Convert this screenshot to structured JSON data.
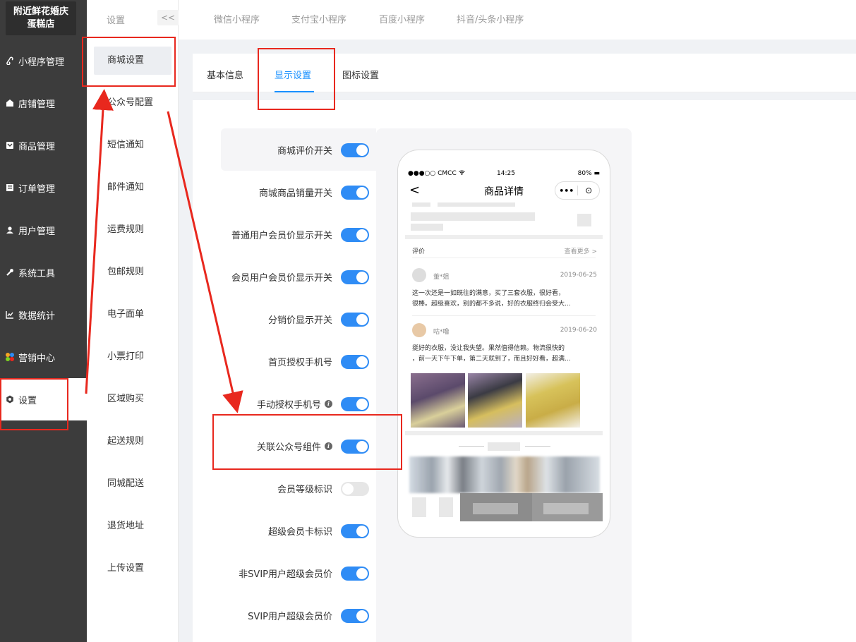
{
  "sidebar": {
    "brand": [
      "附近鲜花婚庆",
      "蛋糕店"
    ],
    "items": [
      {
        "label": "小程序管理",
        "icon": "link-icon"
      },
      {
        "label": "店铺管理",
        "icon": "shop-icon"
      },
      {
        "label": "商品管理",
        "icon": "product-icon"
      },
      {
        "label": "订单管理",
        "icon": "order-icon"
      },
      {
        "label": "用户管理",
        "icon": "user-icon"
      },
      {
        "label": "系统工具",
        "icon": "wrench-icon"
      },
      {
        "label": "数据统计",
        "icon": "chart-icon"
      },
      {
        "label": "营销中心",
        "icon": "marketing-icon"
      },
      {
        "label": "设置",
        "icon": "gear-icon"
      }
    ]
  },
  "sub_sidebar": {
    "heading": "设置",
    "collapse_label": "<<",
    "items": [
      {
        "label": "商城设置"
      },
      {
        "label": "公众号配置"
      },
      {
        "label": "短信通知"
      },
      {
        "label": "邮件通知"
      },
      {
        "label": "运费规则"
      },
      {
        "label": "包邮规则"
      },
      {
        "label": "电子面单"
      },
      {
        "label": "小票打印"
      },
      {
        "label": "区域购买"
      },
      {
        "label": "起送规则"
      },
      {
        "label": "同城配送"
      },
      {
        "label": "退货地址"
      },
      {
        "label": "上传设置"
      }
    ]
  },
  "top_tabs": [
    "微信小程序",
    "支付宝小程序",
    "百度小程序",
    "抖音/头条小程序"
  ],
  "content_tabs": [
    "基本信息",
    "显示设置",
    "图标设置"
  ],
  "settings": [
    {
      "label": "商城评价开关",
      "on": true,
      "info": false
    },
    {
      "label": "商城商品销量开关",
      "on": true,
      "info": false
    },
    {
      "label": "普通用户会员价显示开关",
      "on": true,
      "info": false
    },
    {
      "label": "会员用户会员价显示开关",
      "on": true,
      "info": false
    },
    {
      "label": "分销价显示开关",
      "on": true,
      "info": false
    },
    {
      "label": "首页授权手机号",
      "on": true,
      "info": false
    },
    {
      "label": "手动授权手机号",
      "on": true,
      "info": true
    },
    {
      "label": "关联公众号组件",
      "on": true,
      "info": true
    },
    {
      "label": "会员等级标识",
      "on": false,
      "info": false
    },
    {
      "label": "超级会员卡标识",
      "on": true,
      "info": false
    },
    {
      "label": "非SVIP用户超级会员价",
      "on": true,
      "info": false
    },
    {
      "label": "SVIP用户超级会员价",
      "on": true,
      "info": false
    }
  ],
  "preview": {
    "status_left": "●●●○○ CMCC ",
    "status_time": "14:25",
    "status_right": "80% ▬",
    "back": "<",
    "title": "商品详情",
    "capsule_dots": "•••",
    "capsule_target": "⊙",
    "review_label": "评价",
    "more_label": "查看更多 >",
    "reviews": [
      {
        "name": "董*姐",
        "date": "2019-06-25",
        "lines": [
          "这一次还是一如既往的满意，买了三套衣服，很好看，",
          "很棒。超级喜欢，别的都不多说，好的衣服终归会受大..."
        ]
      },
      {
        "name": "咕*噜",
        "date": "2019-06-20",
        "lines": [
          "挺好的衣服，没让我失望。果然值得信赖。物流很快的",
          "，前一天下午下单，第二天就到了，而且好好看，超满..."
        ]
      }
    ]
  },
  "colors": {
    "accent": "#1890ff",
    "toggle_on": "#2f8cf5",
    "sidebar_bg": "#3c3c3c",
    "annotation": "#e8281e"
  }
}
